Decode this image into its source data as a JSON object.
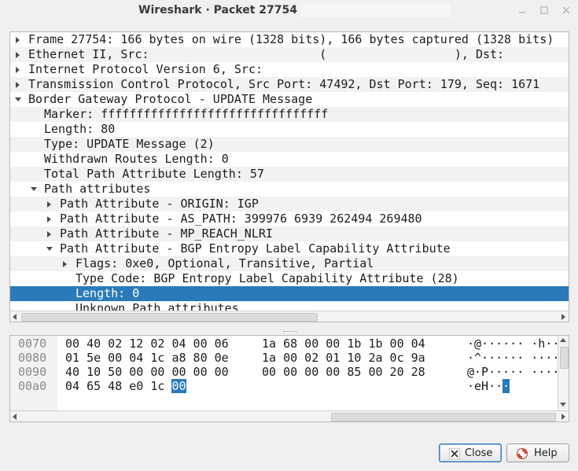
{
  "window": {
    "title": "Wireshark · Packet 27754 ·",
    "controls": {
      "minimize": "minimize-icon",
      "maximize": "maximize-icon",
      "close": "close-icon"
    }
  },
  "tree": {
    "rows": [
      {
        "text": "Frame 27754: 166 bytes on wire (1328 bits), 166 bytes captured (1328 bits)",
        "depth": 0,
        "expander": "collapsed"
      },
      {
        "text": "Ethernet II, Src:                        (                  ), Dst:",
        "depth": 0,
        "expander": "collapsed"
      },
      {
        "text": "Internet Protocol Version 6, Src:",
        "depth": 0,
        "expander": "collapsed"
      },
      {
        "text": "Transmission Control Protocol, Src Port: 47492, Dst Port: 179, Seq: 1671",
        "depth": 0,
        "expander": "collapsed"
      },
      {
        "text": "Border Gateway Protocol - UPDATE Message",
        "depth": 0,
        "expander": "expanded"
      },
      {
        "text": "Marker: ffffffffffffffffffffffffffffffff",
        "depth": 1,
        "expander": "none"
      },
      {
        "text": "Length: 80",
        "depth": 1,
        "expander": "none"
      },
      {
        "text": "Type: UPDATE Message (2)",
        "depth": 1,
        "expander": "none"
      },
      {
        "text": "Withdrawn Routes Length: 0",
        "depth": 1,
        "expander": "none"
      },
      {
        "text": "Total Path Attribute Length: 57",
        "depth": 1,
        "expander": "none"
      },
      {
        "text": "Path attributes",
        "depth": 1,
        "expander": "expanded"
      },
      {
        "text": "Path Attribute - ORIGIN: IGP",
        "depth": 2,
        "expander": "collapsed"
      },
      {
        "text": "Path Attribute - AS_PATH: 399976 6939 262494 269480",
        "depth": 2,
        "expander": "collapsed"
      },
      {
        "text": "Path Attribute - MP_REACH_NLRI",
        "depth": 2,
        "expander": "collapsed"
      },
      {
        "text": "Path Attribute - BGP Entropy Label Capability Attribute",
        "depth": 2,
        "expander": "expanded"
      },
      {
        "text": "Flags: 0xe0, Optional, Transitive, Partial",
        "depth": 3,
        "expander": "collapsed"
      },
      {
        "text": "Type Code: BGP Entropy Label Capability Attribute (28)",
        "depth": 3,
        "expander": "none"
      },
      {
        "text": "Length: 0",
        "depth": 3,
        "expander": "none",
        "selected": true
      },
      {
        "text": "Unknown Path attributes",
        "depth": 3,
        "expander": "none"
      }
    ],
    "hscroll_thumb_fraction": 0.55
  },
  "hex": {
    "lines": [
      {
        "offset": "0070",
        "bytes_a": "00 40 02 12 02 04 00 06",
        "bytes_b": "1a 68 00 00 1b 1b 00 04",
        "ascii": "·@······ ·h···"
      },
      {
        "offset": "0080",
        "bytes_a": "01 5e 00 04 1c a8 80 0e",
        "bytes_b": "1a 00 02 01 10 2a 0c 9a",
        "ascii": "·^······ ····"
      },
      {
        "offset": "0090",
        "bytes_a": "40 10 50 00 00 00 00 00",
        "bytes_b": "00 00 00 00 85 00 20 28",
        "ascii": "@·P····· ····"
      },
      {
        "offset": "00a0",
        "bytes_a": "04 65 48 e0 1c ",
        "highlight_byte": "00",
        "bytes_b": "",
        "ascii": "·eH··",
        "highlight_ascii": "·"
      }
    ]
  },
  "buttons": {
    "close": {
      "label": "Close",
      "icon": "close-x-icon"
    },
    "help": {
      "label": "Help",
      "icon": "help-icon"
    }
  },
  "colors": {
    "selection": "#2a7ab9",
    "alt_row": "#f2f2f2",
    "window_bg": "#efefef"
  }
}
